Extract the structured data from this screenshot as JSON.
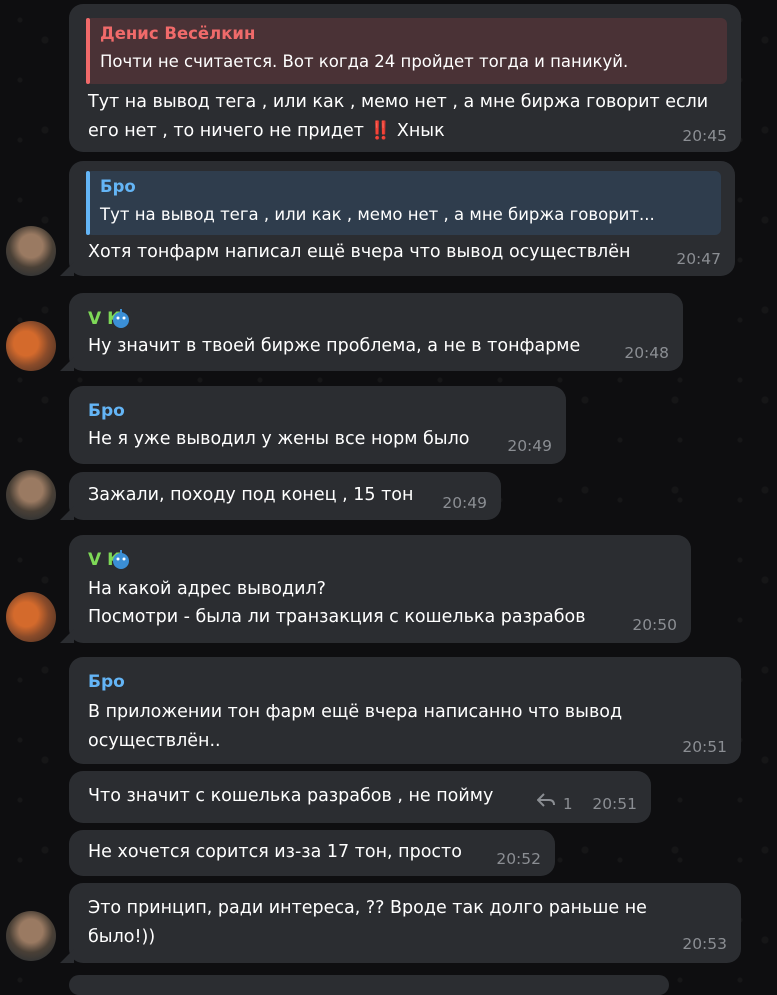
{
  "colors": {
    "bubble": "#2b2d31",
    "sender_bro": "#64b5f6",
    "sender_vk": "#7ed957",
    "sender_denis": "#f06a6a",
    "time": "#8b8e93",
    "background": "#0e0e10"
  },
  "messages": [
    {
      "reply_name": "Денис Весёлкин",
      "reply_text": "Почти не считается. Вот когда 24 пройдет тогда и паникуй.",
      "lines": [
        "Тут на вывод тега , или как , мемо нет , а мне биржа говорит если",
        "его нет , то ничего не придет ‼️ Хнык"
      ],
      "time": "20:45"
    },
    {
      "reply_name": "Бро",
      "reply_text": "Тут на вывод тега , или как , мемо нет , а мне биржа говорит...",
      "lines": [
        "Хотя тонфарм написал ещё вчера что вывод осуществлён"
      ],
      "time": "20:47"
    },
    {
      "sender": "V K",
      "lines": [
        "Ну значит в твоей бирже проблема, а не в тонфарме"
      ],
      "time": "20:48"
    },
    {
      "sender": "Бро",
      "lines": [
        "Не я уже выводил у жены все норм было"
      ],
      "time": "20:49"
    },
    {
      "lines": [
        "Зажали, походу под конец , 15 тон"
      ],
      "time": "20:49"
    },
    {
      "sender": "V K",
      "lines": [
        "На какой адрес выводил?",
        "Посмотри - была ли транзакция с кошелька разрабов"
      ],
      "time": "20:50"
    },
    {
      "sender": "Бро",
      "lines": [
        "В приложении тон фарм ещё вчера написанно что вывод",
        "осуществлён.."
      ],
      "time": "20:51"
    },
    {
      "lines": [
        "Что значит с кошелька разрабов , не пойму"
      ],
      "reply_count": "1",
      "time": "20:51"
    },
    {
      "lines": [
        "Не хочется сорится из-за 17 тон, просто"
      ],
      "time": "20:52"
    },
    {
      "lines": [
        "Это принцип, ради интереса, ?? Вроде так долго раньше не",
        "было!))"
      ],
      "time": "20:53"
    }
  ]
}
